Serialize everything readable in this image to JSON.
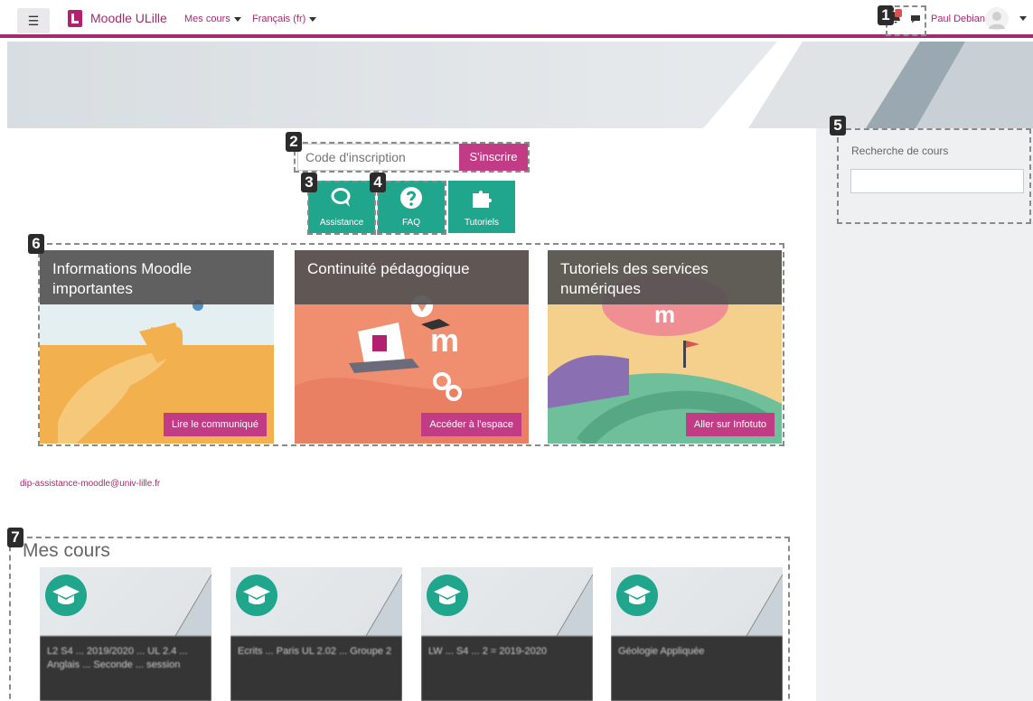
{
  "navbar": {
    "menu_icon": "hamburger-icon",
    "brand": "Moodle ULille",
    "my_courses": "Mes cours",
    "language": "Français (fr)",
    "user_name": "Paul Debian",
    "notification_count": "1"
  },
  "annotations": [
    "1",
    "2",
    "3",
    "4",
    "5",
    "6",
    "7"
  ],
  "enrolment": {
    "placeholder": "Code d'inscription",
    "button": "S'inscrire"
  },
  "quick_links": [
    {
      "label": "Assistance",
      "icon": "chat-bubbles-icon"
    },
    {
      "label": "FAQ",
      "icon": "question-icon"
    },
    {
      "label": "Tutoriels",
      "icon": "puzzle-icon"
    }
  ],
  "cards": [
    {
      "title": "Informations Moodle importantes",
      "button": "Lire le communiqué"
    },
    {
      "title": "Continuité pédagogique",
      "button": "Accéder à l'espace"
    },
    {
      "title": "Tutoriels des services numériques",
      "button": "Aller sur Infotuto"
    }
  ],
  "contact_email": "dip-assistance-moodle@univ-lille.fr",
  "side_panel": {
    "search_label": "Recherche de cours",
    "search_value": ""
  },
  "my_courses": {
    "title": "Mes cours",
    "courses": [
      {
        "name": "L2 S4 ... 2019/2020 ... UL 2.4 ... Anglais ... Seconde ... session"
      },
      {
        "name": "Ecrits ... Paris UL 2.02 ... Groupe 2"
      },
      {
        "name": "LW ... S4 ... 2 = 2019-2020"
      },
      {
        "name": "Géologie Appliquée"
      }
    ]
  },
  "colors": {
    "accent": "#a12b6d",
    "button": "#c13b85",
    "teal": "#20a68c"
  }
}
